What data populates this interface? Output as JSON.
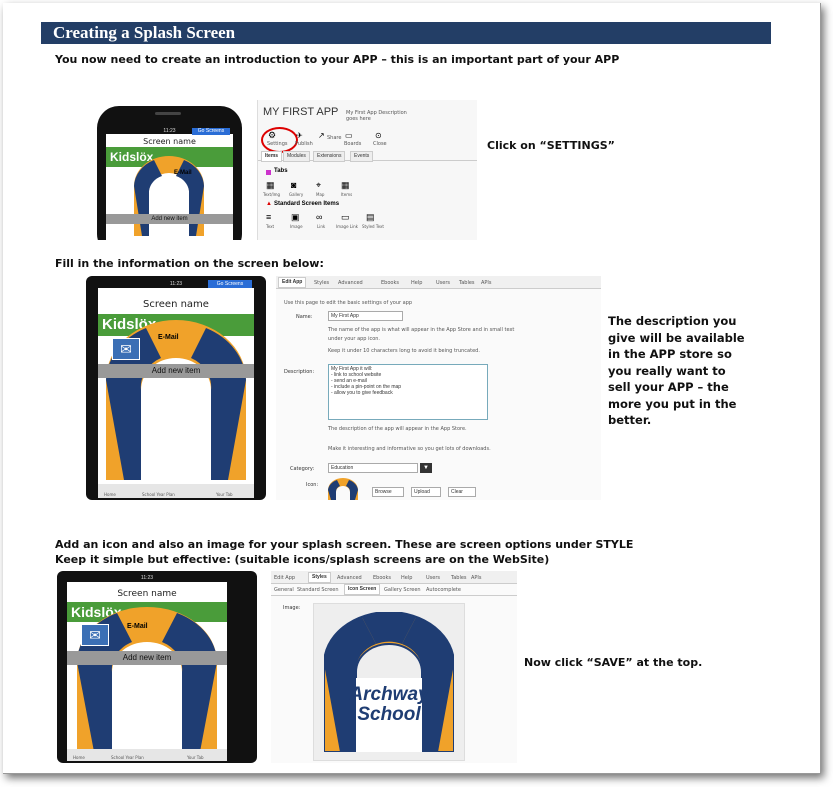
{
  "header": {
    "title": "Creating a Splash Screen"
  },
  "intro": "You now need to create an introduction to your APP – this is an important part of your APP",
  "section1": {
    "app_title": "MY FIRST APP",
    "app_desc": "My First App Description goes here",
    "toolbar": [
      "Settings",
      "Publish",
      "Share",
      "Boards",
      "Close"
    ],
    "subtabs": [
      "Items",
      "Modules",
      "Extensions",
      "Events"
    ],
    "tabs_label": "Tabs",
    "tab_icons": [
      "Text/Img",
      "Gallery",
      "Map",
      "Items"
    ],
    "standard_label": "Standard Screen Items",
    "std_icons": [
      "Text",
      "Image",
      "Link",
      "Image Link",
      "Styled Text"
    ],
    "caption": "Click on “SETTINGS”"
  },
  "phone": {
    "screen_name": "Screen name",
    "banner": "Kidslöx",
    "button": "Go Screens",
    "email": "E-Mail",
    "add_item": "Add new item",
    "tabs": [
      "Home",
      "School Year Plan",
      "Your Tab"
    ],
    "time": "11:23"
  },
  "section2": {
    "heading": "Fill in the information on the screen below:",
    "tabs": [
      "Edit App",
      "Styles",
      "Advanced",
      "Ebooks",
      "Help",
      "Users",
      "Tables",
      "APIs"
    ],
    "hint": "Use this page to edit the basic settings of your app",
    "name_label": "Name:",
    "name_value": "My First App",
    "name_help1": "The name of the app is what will appear in the App Store and in small text",
    "name_help2": "under your app icon.",
    "name_help3": "Keep it under 10 characters long to avoid it being truncated.",
    "desc_label": "Description:",
    "desc_lines": [
      "My First App it will:",
      "- link to school website",
      "- send an e-mail",
      "- include a pin-point on the map",
      "- allow you to give feedback"
    ],
    "desc_help1": "The description of the app will appear in the App Store.",
    "desc_help2": "Make it interesting and informative so you get lots of downloads.",
    "category_label": "Category:",
    "category_value": "Education",
    "icon_label": "Icon:",
    "icon_buttons": [
      "Browse",
      "Upload",
      "Clear"
    ],
    "caption_lines": [
      "The description you",
      "give will be available",
      "in the APP store so",
      "you really want to",
      "sell your APP – the",
      "more you put in the",
      "better."
    ]
  },
  "section3": {
    "line1": "Add an icon and also an image for your splash screen. These are screen options under STYLE",
    "line2": " Keep it simple but effective: (suitable icons/splash screens are on the WebSite)",
    "tabs": [
      "Edit App",
      "Styles",
      "Advanced",
      "Ebooks",
      "Help",
      "Users",
      "Tables",
      "APIs"
    ],
    "subtabs": [
      "General",
      "Standard Screen",
      "Icon Screen",
      "Gallery Screen",
      "Autocomplete"
    ],
    "image_label": "Image:",
    "splash_text1": "Archway",
    "splash_text2": "School",
    "caption": "Now click “SAVE” at the top."
  },
  "colors": {
    "header_bg": "#233e66",
    "arch_navy": "#1f3d73",
    "arch_orange": "#f0a22a",
    "banner_green": "#4a9c3a"
  }
}
